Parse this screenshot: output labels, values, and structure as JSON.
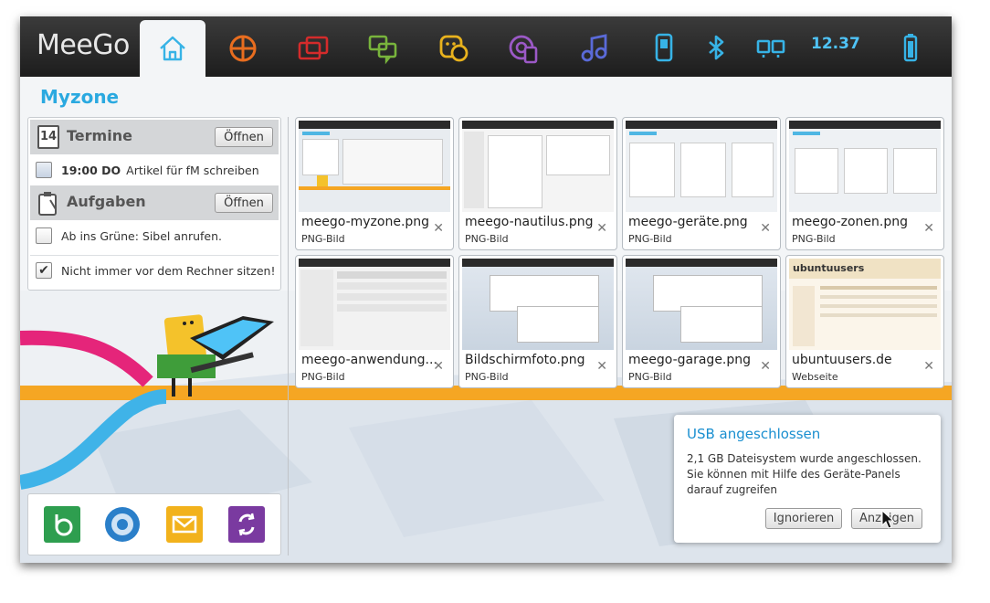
{
  "topbar": {
    "logo": "MeeGo",
    "clock": "12.37",
    "tabs": [
      {
        "name": "myzone",
        "icon": "home-icon",
        "color": "#37b3e6"
      },
      {
        "name": "zones",
        "icon": "zones-icon",
        "color": "#e86d1f"
      },
      {
        "name": "applications",
        "icon": "applications-icon",
        "color": "#d42b2b"
      },
      {
        "name": "status",
        "icon": "chat-icon",
        "color": "#78b43c"
      },
      {
        "name": "people",
        "icon": "people-icon",
        "color": "#e8b21d"
      },
      {
        "name": "internet",
        "icon": "internet-icon",
        "color": "#9b59c6"
      },
      {
        "name": "media",
        "icon": "music-icon",
        "color": "#5a6ad8"
      },
      {
        "name": "devices",
        "icon": "device-icon",
        "color": "#37b3e6"
      },
      {
        "name": "bluetooth",
        "icon": "bluetooth-icon",
        "color": "#37b3e6"
      },
      {
        "name": "network",
        "icon": "network-icon",
        "color": "#37b3e6"
      },
      {
        "name": "battery",
        "icon": "battery-icon",
        "color": "#37b3e6"
      }
    ]
  },
  "zone": {
    "title": "Myzone"
  },
  "appointments": {
    "title": "Termine",
    "calendar_day": "14",
    "open_label": "Öffnen",
    "entries": [
      {
        "time": "19:00 DO",
        "text": "Artikel für fM schreiben"
      }
    ]
  },
  "tasks": {
    "title": "Aufgaben",
    "open_label": "Öffnen",
    "items": [
      {
        "text": "Ab ins Grüne: Sibel anrufen.",
        "checked": false
      },
      {
        "text": "Nicht immer vor dem Rechner sitzen!",
        "checked": true
      }
    ]
  },
  "files": [
    {
      "name": "meego-myzone.png",
      "type": "PNG-Bild"
    },
    {
      "name": "meego-nautilus.png",
      "type": "PNG-Bild"
    },
    {
      "name": "meego-geräte.png",
      "type": "PNG-Bild"
    },
    {
      "name": "meego-zonen.png",
      "type": "PNG-Bild"
    },
    {
      "name": "meego-anwendung...",
      "type": "PNG-Bild"
    },
    {
      "name": "Bildschirmfoto.png",
      "type": "PNG-Bild"
    },
    {
      "name": "meego-garage.png",
      "type": "PNG-Bild"
    },
    {
      "name": "ubuntuusers.de",
      "type": "Webseite"
    }
  ],
  "thumb_texts": {
    "ubuntuusers_header": "ubuntuusers"
  },
  "dock": [
    {
      "icon": "tasks-app-icon",
      "color": "#2e9e4f"
    },
    {
      "icon": "browser-icon",
      "color": "#2a7fc9"
    },
    {
      "icon": "email-icon",
      "color": "#f2b21c"
    },
    {
      "icon": "sync-icon",
      "color": "#7a3aa0"
    }
  ],
  "notification": {
    "title": "USB angeschlossen",
    "line1": "2,1 GB Dateisystem wurde angeschlossen.",
    "line2": "Sie können mit Hilfe des Geräte-Panels",
    "line3": "darauf zugreifen",
    "ignore_label": "Ignorieren",
    "show_label": "Anzeigen"
  }
}
